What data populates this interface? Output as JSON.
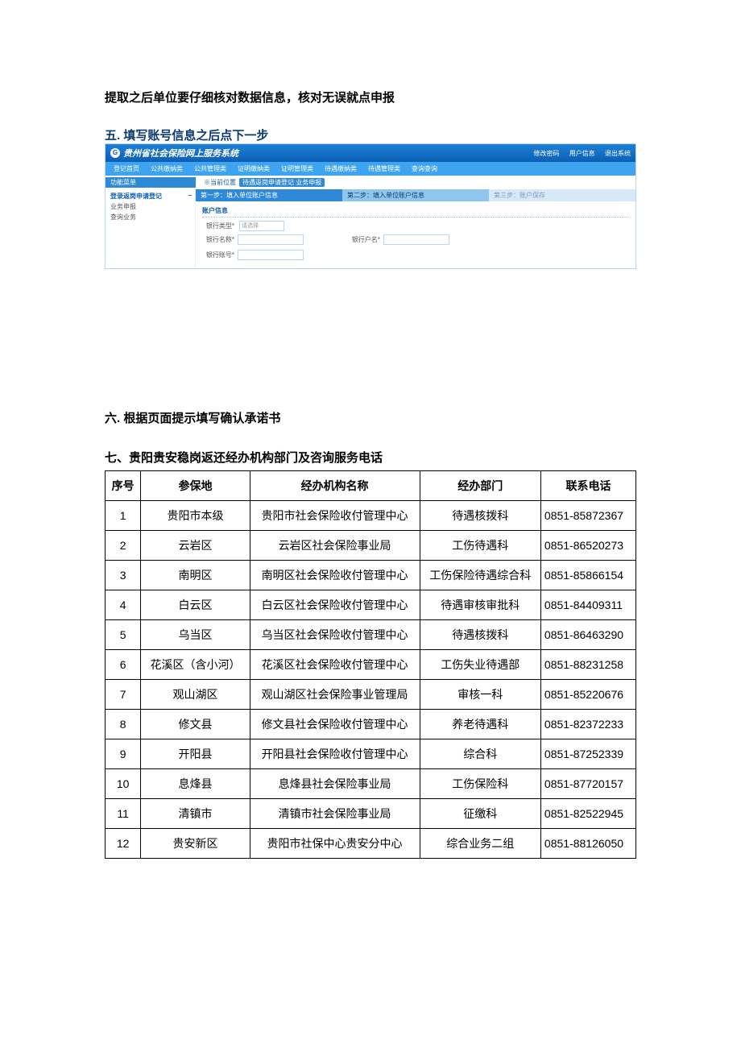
{
  "intro": "提取之后单位要仔细核对数据信息，核对无误就点申报",
  "sec5": "五. 填写账号信息之后点下一步",
  "sec6": "六. 根据页面提示填写确认承诺书",
  "sec7": "七、贵阳贵安稳岗返还经办机构部门及咨询服务电话",
  "app": {
    "title": "贵州省社会保险网上服务系统",
    "top_links": [
      "修改密码",
      "用户信息",
      "退出系统"
    ],
    "menus": [
      "登记首页",
      "公共缴纳类",
      "公共管理类",
      "证明缴纳类",
      "证明管理类",
      "待遇缴纳类",
      "待遇管理类",
      "查询查询"
    ],
    "side_hdr": "功能菜单",
    "side_items": [
      "登录返岗申请登记",
      "业务申报",
      "查询业务"
    ],
    "crumb_label": "※当前位置",
    "crumb_tag": "待遇返岗申请登记 业务申报",
    "step1": "第一步：填入单位账户信息",
    "step2": "第二步：填入单位账户信息",
    "step3": "第三步：账户保存",
    "form_title": "账户信息",
    "labels": {
      "type": "银行类型*",
      "name": "银行名称*",
      "branch": "银行户名*",
      "acct": "银行账号*"
    },
    "select_opt": "请选择"
  },
  "table": {
    "headers": [
      "序号",
      "参保地",
      "经办机构名称",
      "经办部门",
      "联系电话"
    ],
    "rows": [
      [
        "1",
        "贵阳市本级",
        "贵阳市社会保险收付管理中心",
        "待遇核拨科",
        "0851-85872367"
      ],
      [
        "2",
        "云岩区",
        "云岩区社会保险事业局",
        "工伤待遇科",
        "0851-86520273"
      ],
      [
        "3",
        "南明区",
        "南明区社会保险收付管理中心",
        "工伤保险待遇综合科",
        "0851-85866154"
      ],
      [
        "4",
        "白云区",
        "白云区社会保险收付管理中心",
        "待遇审核审批科",
        "0851-84409311"
      ],
      [
        "5",
        "乌当区",
        "乌当区社会保险收付管理中心",
        "待遇核拨科",
        "0851-86463290"
      ],
      [
        "6",
        "花溪区（含小河）",
        "花溪区社会保险收付管理中心",
        "工伤失业待遇部",
        "0851-88231258"
      ],
      [
        "7",
        "观山湖区",
        "观山湖区社会保险事业管理局",
        "审核一科",
        "0851-85220676"
      ],
      [
        "8",
        "修文县",
        "修文县社会保险收付管理中心",
        "养老待遇科",
        "0851-82372233"
      ],
      [
        "9",
        "开阳县",
        "开阳县社会保险收付管理中心",
        "综合科",
        "0851-87252339"
      ],
      [
        "10",
        "息烽县",
        "息烽县社会保险事业局",
        "工伤保险科",
        "0851-87720157"
      ],
      [
        "11",
        "清镇市",
        "清镇市社会保险事业局",
        "征缴科",
        "0851-82522945"
      ],
      [
        "12",
        "贵安新区",
        "贵阳市社保中心贵安分中心",
        "综合业务二组",
        "0851-88126050"
      ]
    ]
  }
}
